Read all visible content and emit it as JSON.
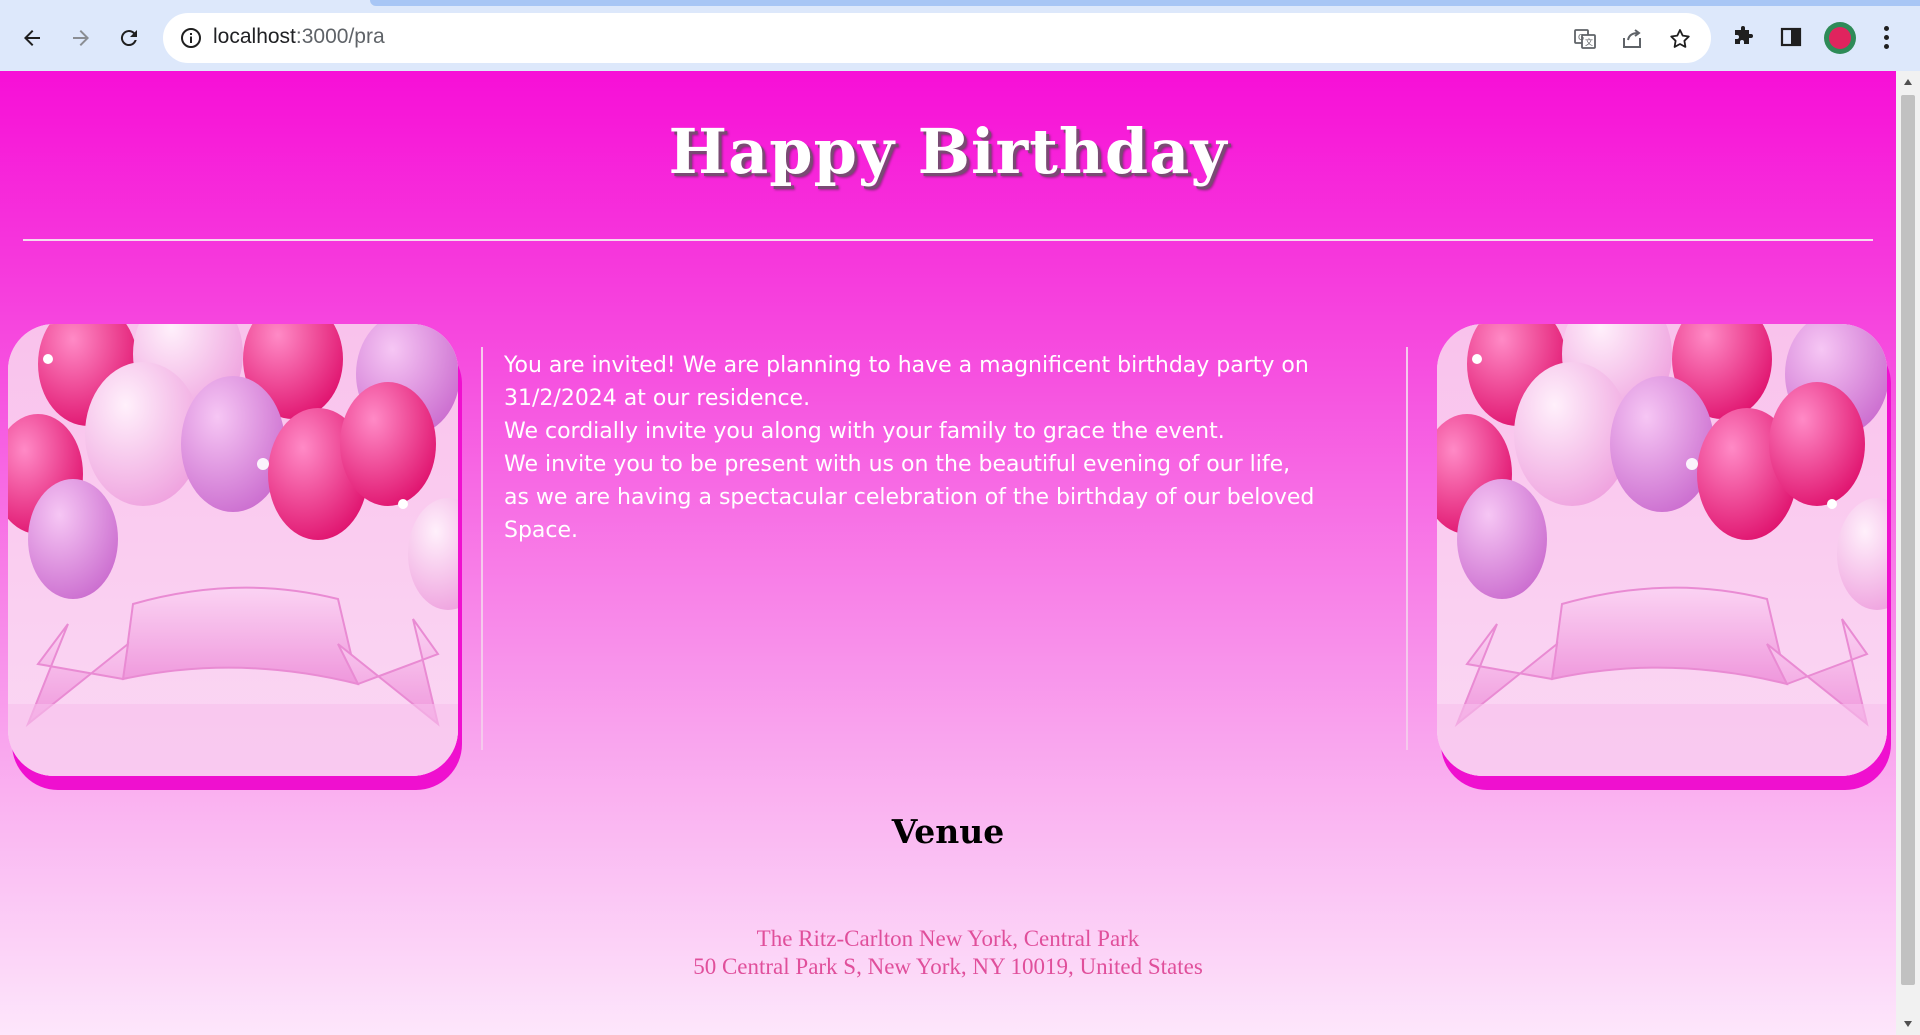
{
  "browser": {
    "url_host": "localhost",
    "url_path": ":3000/pra",
    "icons": [
      "back-icon",
      "forward-icon",
      "reload-icon",
      "info-icon",
      "translate-icon",
      "share-icon",
      "bookmark-star-icon",
      "extensions-icon",
      "side-panel-icon",
      "profile-avatar",
      "menu-icon"
    ]
  },
  "page": {
    "title": "Happy Birthday",
    "invitation_lines": [
      "You are invited! We are planning to have a magnificent birthday party on",
      "31/2/2024 at our residence.",
      "We cordially invite you along with your family to grace the event.",
      "We invite you to be present with us on the beautiful evening of our life,",
      "as we are having a spectacular celebration of the birthday of our beloved",
      "Space."
    ],
    "venue": {
      "heading": "Venue",
      "name": "The Ritz-Carlton New York, Central Park",
      "address": "50 Central Park S, New York, NY 10019, United States"
    }
  },
  "colors": {
    "background_top": "#f70fd7",
    "background_bottom": "#fde6fb",
    "venue_text": "#e04f9b",
    "photo_shadow": "#ef10cf"
  }
}
